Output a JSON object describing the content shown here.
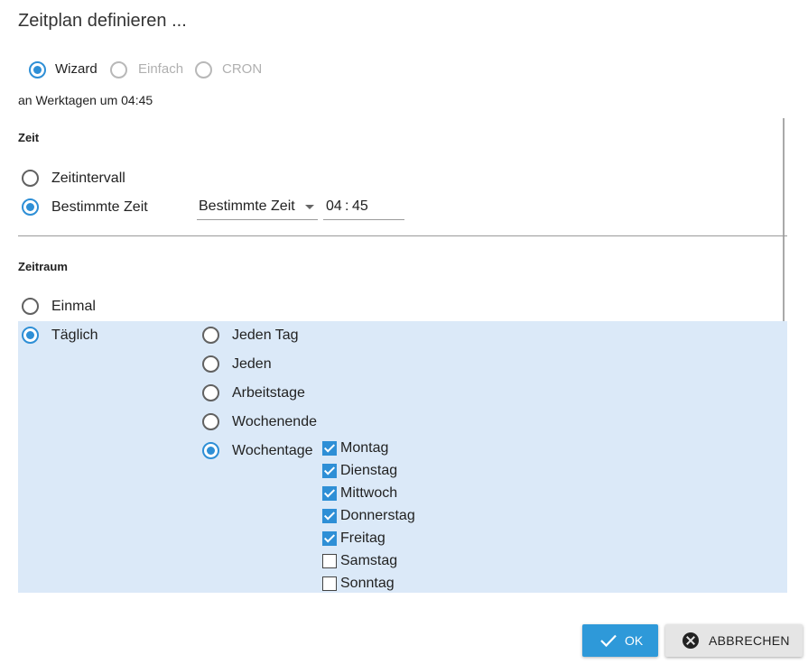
{
  "dialog": {
    "title": "Zeitplan definieren ..."
  },
  "mode": {
    "options": [
      {
        "label": "Wizard",
        "selected": true,
        "disabled": false
      },
      {
        "label": "Einfach",
        "selected": false,
        "disabled": true
      },
      {
        "label": "CRON",
        "selected": false,
        "disabled": true
      }
    ]
  },
  "summary": "an Werktagen um 04:45",
  "zeit": {
    "heading": "Zeit",
    "options": [
      {
        "label": "Zeitintervall",
        "selected": false
      },
      {
        "label": "Bestimmte Zeit",
        "selected": true
      }
    ],
    "select_value": "Bestimmte Zeit",
    "time_hours": "04",
    "time_sep": ":",
    "time_minutes": "45"
  },
  "zeitraum": {
    "heading": "Zeitraum",
    "options": [
      {
        "label": "Einmal",
        "selected": false
      },
      {
        "label": "Täglich",
        "selected": true
      }
    ],
    "daily": [
      {
        "label": "Jeden Tag",
        "selected": false
      },
      {
        "label": "Jeden",
        "selected": false
      },
      {
        "label": "Arbeitstage",
        "selected": false
      },
      {
        "label": "Wochenende",
        "selected": false
      },
      {
        "label": "Wochentage",
        "selected": true
      }
    ],
    "weekdays": [
      {
        "label": "Montag",
        "checked": true
      },
      {
        "label": "Dienstag",
        "checked": true
      },
      {
        "label": "Mittwoch",
        "checked": true
      },
      {
        "label": "Donnerstag",
        "checked": true
      },
      {
        "label": "Freitag",
        "checked": true
      },
      {
        "label": "Samstag",
        "checked": false
      },
      {
        "label": "Sonntag",
        "checked": false
      }
    ]
  },
  "buttons": {
    "ok_label": "OK",
    "ok_icon": "check-icon",
    "cancel_label": "ABBRECHEN",
    "cancel_icon": "close-circle-icon"
  },
  "colors": {
    "accent": "#2e8fd6",
    "highlight": "#dbe9f8",
    "ok_button": "#2e99d9"
  }
}
